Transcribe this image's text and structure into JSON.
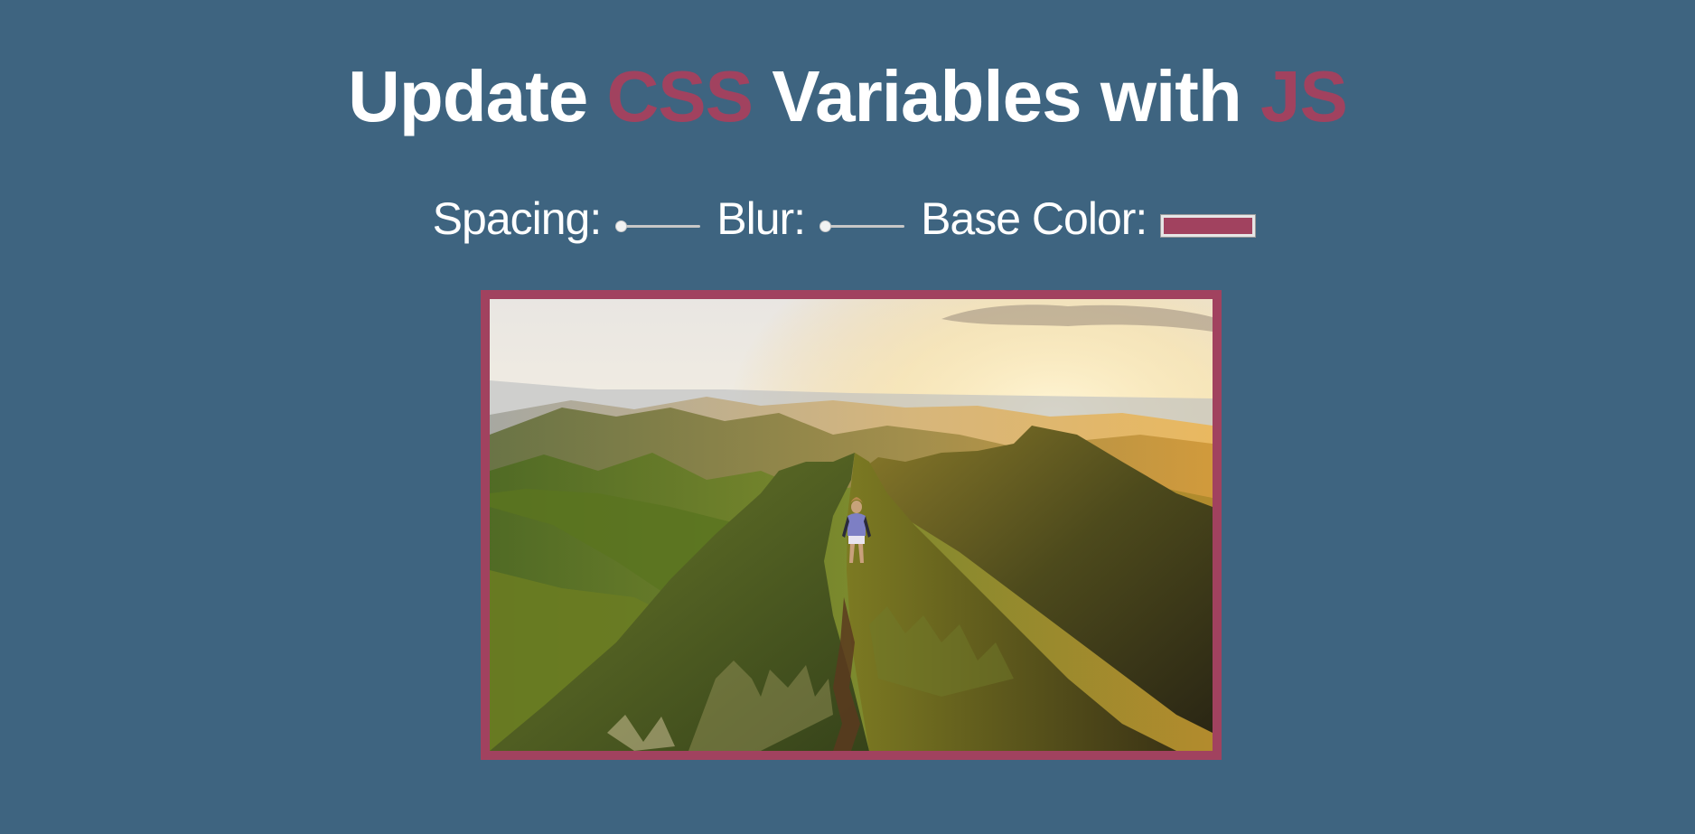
{
  "header": {
    "title_part1": "Update",
    "title_hl1": "CSS",
    "title_part2": "Variables with",
    "title_hl2": "JS"
  },
  "controls": {
    "spacing_label": "Spacing:",
    "spacing_value": 0,
    "blur_label": "Blur:",
    "blur_value": 0,
    "base_color_label": "Base Color:",
    "base_color_value": "#a1425f"
  },
  "colors": {
    "background": "#3e6480",
    "accent": "#a1425f",
    "text": "#ffffff"
  },
  "image": {
    "subject": "hiker-on-mountain-ridge-at-sunset"
  }
}
